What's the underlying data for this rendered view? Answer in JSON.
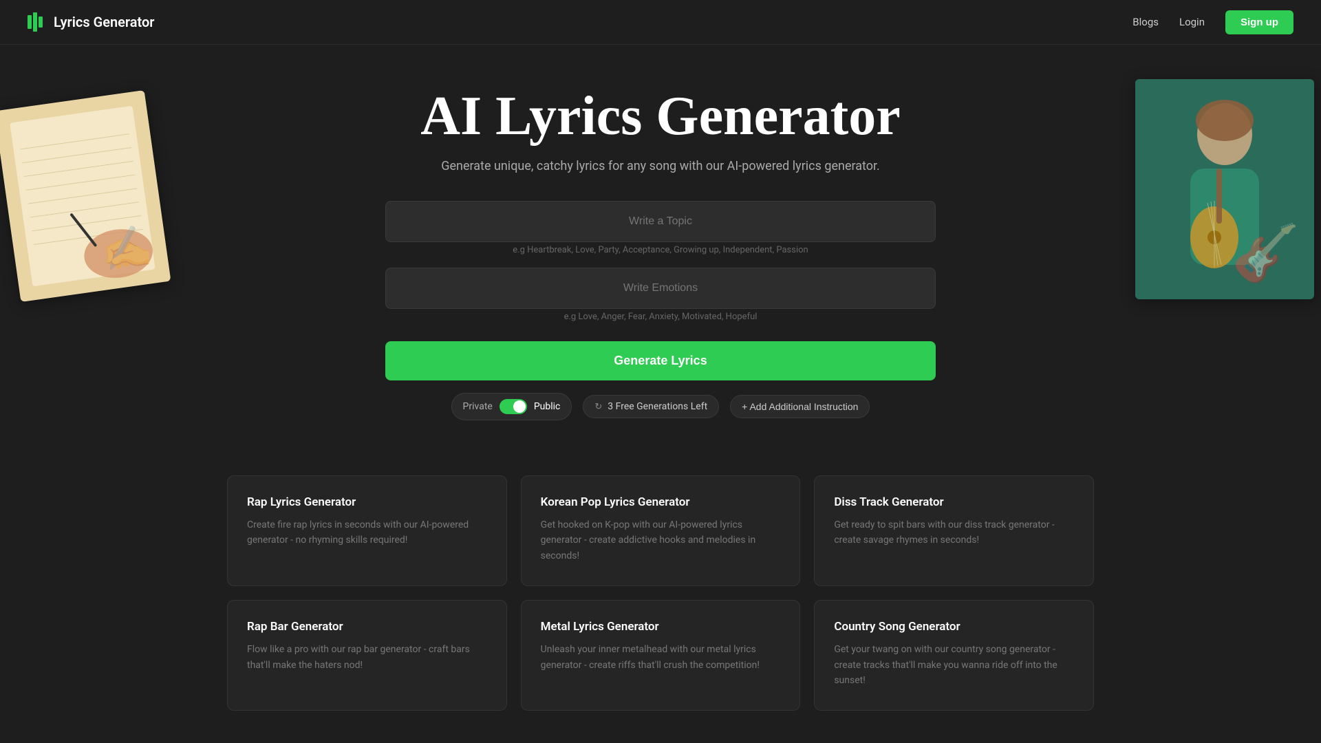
{
  "app": {
    "name": "Lyrics Generator",
    "logo_alt": "Lyrics Generator Logo"
  },
  "navbar": {
    "blogs_label": "Blogs",
    "login_label": "Login",
    "signup_label": "Sign up"
  },
  "hero": {
    "title": "AI Lyrics Generator",
    "subtitle": "Generate unique, catchy lyrics for any song with our AI-powered lyrics generator.",
    "topic_placeholder": "Write a Topic",
    "topic_hint": "e.g Heartbreak, Love, Party, Acceptance, Growing up, Independent, Passion",
    "emotions_placeholder": "Write Emotions",
    "emotions_hint": "e.g Love, Anger, Fear, Anxiety, Motivated, Hopeful",
    "generate_label": "Generate Lyrics"
  },
  "controls": {
    "private_label": "Private",
    "public_label": "Public",
    "generations_left": "3 Free Generations Left",
    "add_instruction_label": "+ Add Additional Instruction"
  },
  "cards": [
    {
      "title": "Rap Lyrics Generator",
      "description": "Create fire rap lyrics in seconds with our AI-powered generator - no rhyming skills required!"
    },
    {
      "title": "Korean Pop Lyrics Generator",
      "description": "Get hooked on K-pop with our AI-powered lyrics generator - create addictive hooks and melodies in seconds!"
    },
    {
      "title": "Diss Track Generator",
      "description": "Get ready to spit bars with our diss track generator - create savage rhymes in seconds!"
    },
    {
      "title": "Rap Bar Generator",
      "description": "Flow like a pro with our rap bar generator - craft bars that'll make the haters nod!"
    },
    {
      "title": "Metal Lyrics Generator",
      "description": "Unleash your inner metalhead with our metal lyrics generator - create riffs that'll crush the competition!"
    },
    {
      "title": "Country Song Generator",
      "description": "Get your twang on with our country song generator - create tracks that'll make you wanna ride off into the sunset!"
    }
  ]
}
